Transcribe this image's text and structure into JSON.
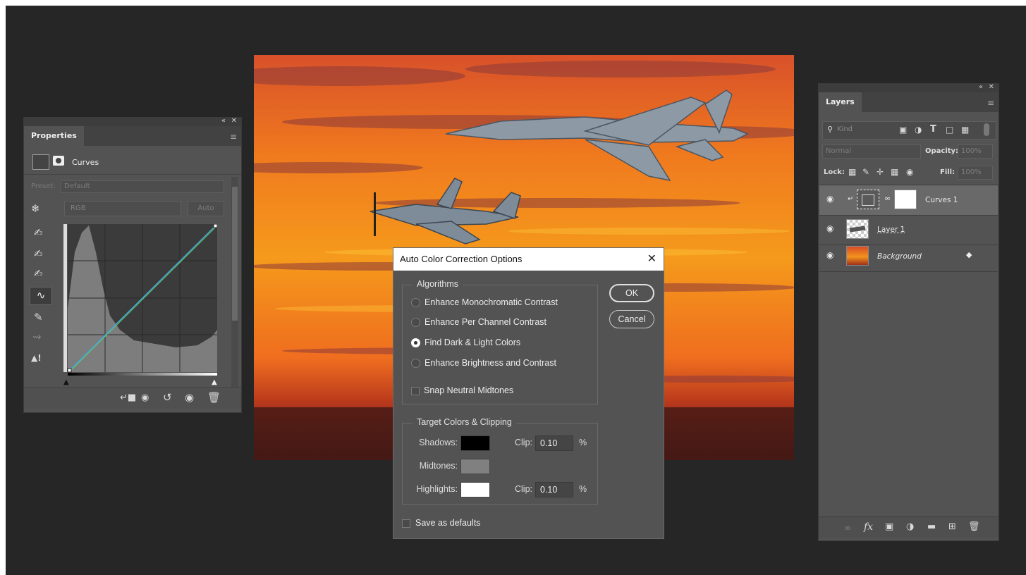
{
  "colors": {
    "app_bg": "#262626",
    "panel_bg": "#535353",
    "dialog_title_bg": "#ffffff",
    "curve_line": "#4a9fd8",
    "shadow_swatch": "#000000",
    "midtone_swatch": "#808080",
    "highlight_swatch": "#ffffff"
  },
  "properties": {
    "tab": "Properties",
    "adjustment": "Curves",
    "preset_label": "Preset:",
    "preset_value": "Default",
    "channel": "RGB",
    "auto_label": "Auto",
    "left_tools": [
      "on-image-adjust-icon",
      "eyedropper-black-icon",
      "eyedropper-gray-icon",
      "eyedropper-white-icon",
      "curve-points-icon",
      "pencil-icon",
      "smooth-icon",
      "clipping-warning-icon"
    ],
    "bottom_icons": [
      "clip-to-layer-icon",
      "view-previous-icon",
      "reset-icon",
      "visibility-icon",
      "trash-icon"
    ]
  },
  "dialog": {
    "title": "Auto Color Correction Options",
    "algorithms_label": "Algorithms",
    "algorithms": [
      {
        "label": "Enhance Monochromatic Contrast",
        "selected": false
      },
      {
        "label": "Enhance Per Channel Contrast",
        "selected": false
      },
      {
        "label": "Find Dark & Light Colors",
        "selected": true
      },
      {
        "label": "Enhance Brightness and Contrast",
        "selected": false
      }
    ],
    "snap_label": "Snap Neutral Midtones",
    "snap_checked": false,
    "ok_label": "OK",
    "cancel_label": "Cancel",
    "target_label": "Target Colors & Clipping",
    "shadows_label": "Shadows:",
    "midtones_label": "Midtones:",
    "highlights_label": "Highlights:",
    "clip_label": "Clip:",
    "shadows_clip": "0.10",
    "highlights_clip": "0.10",
    "percent": "%",
    "save_defaults_label": "Save as defaults",
    "save_defaults_checked": false
  },
  "layers": {
    "tab": "Layers",
    "filter_placeholder": "Kind",
    "blend_mode": "Normal",
    "opacity_label": "Opacity:",
    "opacity_value": "100%",
    "lock_label": "Lock:",
    "fill_label": "Fill:",
    "fill_value": "100%",
    "items": [
      {
        "name": "Curves 1",
        "selected": true
      },
      {
        "name": "Layer 1",
        "selected": false
      },
      {
        "name": "Background",
        "selected": false,
        "locked": true
      }
    ],
    "bottom_icons": [
      "link-icon",
      "fx-icon",
      "mask-icon",
      "adjustment-icon",
      "folder-icon",
      "new-layer-icon",
      "trash-icon"
    ]
  }
}
